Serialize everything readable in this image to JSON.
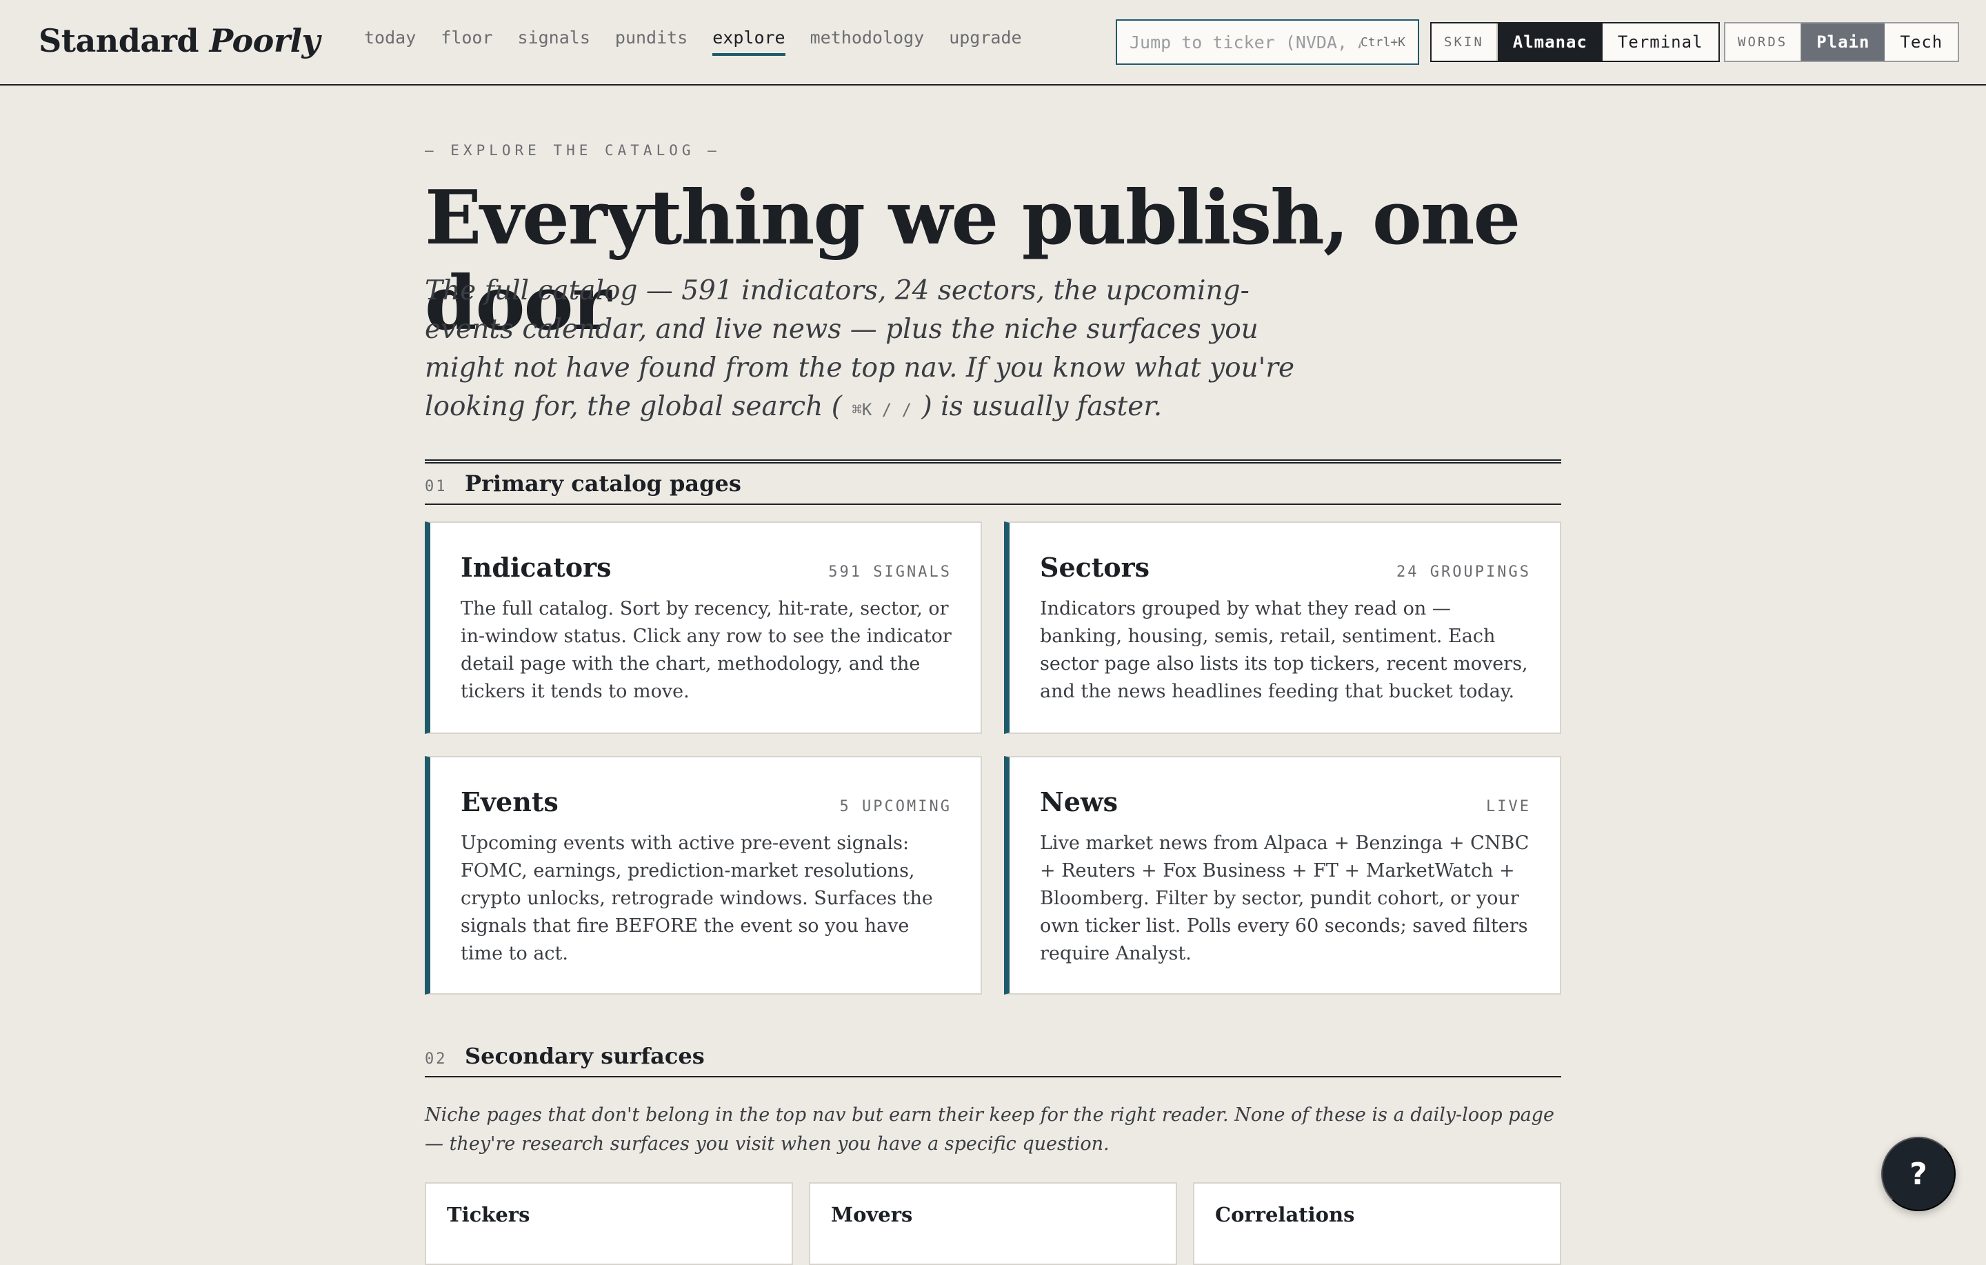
{
  "brand": {
    "name_regular": "Standard ",
    "name_italic": "Poorly"
  },
  "nav": {
    "items": [
      {
        "label": "today"
      },
      {
        "label": "floor"
      },
      {
        "label": "signals"
      },
      {
        "label": "pundits"
      },
      {
        "label": "explore",
        "active": true
      },
      {
        "label": "methodology"
      },
      {
        "label": "upgrade"
      }
    ]
  },
  "search": {
    "placeholder": "Jump to ticker (NVDA, AAPL)…",
    "shortcut": "Ctrl+K"
  },
  "skin": {
    "label": "SKIN",
    "options": [
      "Almanac",
      "Terminal"
    ],
    "selected": "Almanac"
  },
  "words": {
    "label": "WORDS",
    "options": [
      "Plain",
      "Tech"
    ],
    "selected": "Plain"
  },
  "hero": {
    "kicker": "— EXPLORE THE CATALOG —",
    "title": "Everything we publish, one door",
    "subtitle_pre": "The full catalog — 591 indicators, 24 sectors, the upcoming-events calendar, and live news — plus the niche surfaces you might not have found from the top nav. If you know what you're looking for, the global search (",
    "subtitle_keys": " ⌘K / / ",
    "subtitle_post": ") is usually faster."
  },
  "section1": {
    "num": "01",
    "title": "Primary catalog pages",
    "cards": [
      {
        "title": "Indicators",
        "meta": "591 SIGNALS",
        "body": "The full catalog. Sort by recency, hit-rate, sector, or in-window status. Click any row to see the indicator detail page with the chart, methodology, and the tickers it tends to move."
      },
      {
        "title": "Sectors",
        "meta": "24 GROUPINGS",
        "body": "Indicators grouped by what they read on — banking, housing, semis, retail, sentiment. Each sector page also lists its top tickers, recent movers, and the news headlines feeding that bucket today."
      },
      {
        "title": "Events",
        "meta": "5 UPCOMING",
        "body": "Upcoming events with active pre-event signals: FOMC, earnings, prediction-market resolutions, crypto unlocks, retrograde windows. Surfaces the signals that fire BEFORE the event so you have time to act."
      },
      {
        "title": "News",
        "meta": "LIVE",
        "body": "Live market news from Alpaca + Benzinga + CNBC + Reuters + Fox Business + FT + MarketWatch + Bloomberg. Filter by sector, pundit cohort, or your own ticker list. Polls every 60 seconds; saved filters require Analyst."
      }
    ]
  },
  "section2": {
    "num": "02",
    "title": "Secondary surfaces",
    "subtitle": "Niche pages that don't belong in the top nav but earn their keep for the right reader. None of these is a daily-loop page — they're research surfaces you visit when you have a specific question.",
    "cards": [
      {
        "title": "Tickers"
      },
      {
        "title": "Movers"
      },
      {
        "title": "Correlations"
      }
    ]
  },
  "help": {
    "label": "?"
  },
  "colors": {
    "accent": "#1f5a6b",
    "ink": "#1c1f24",
    "paper": "#edeae4"
  }
}
